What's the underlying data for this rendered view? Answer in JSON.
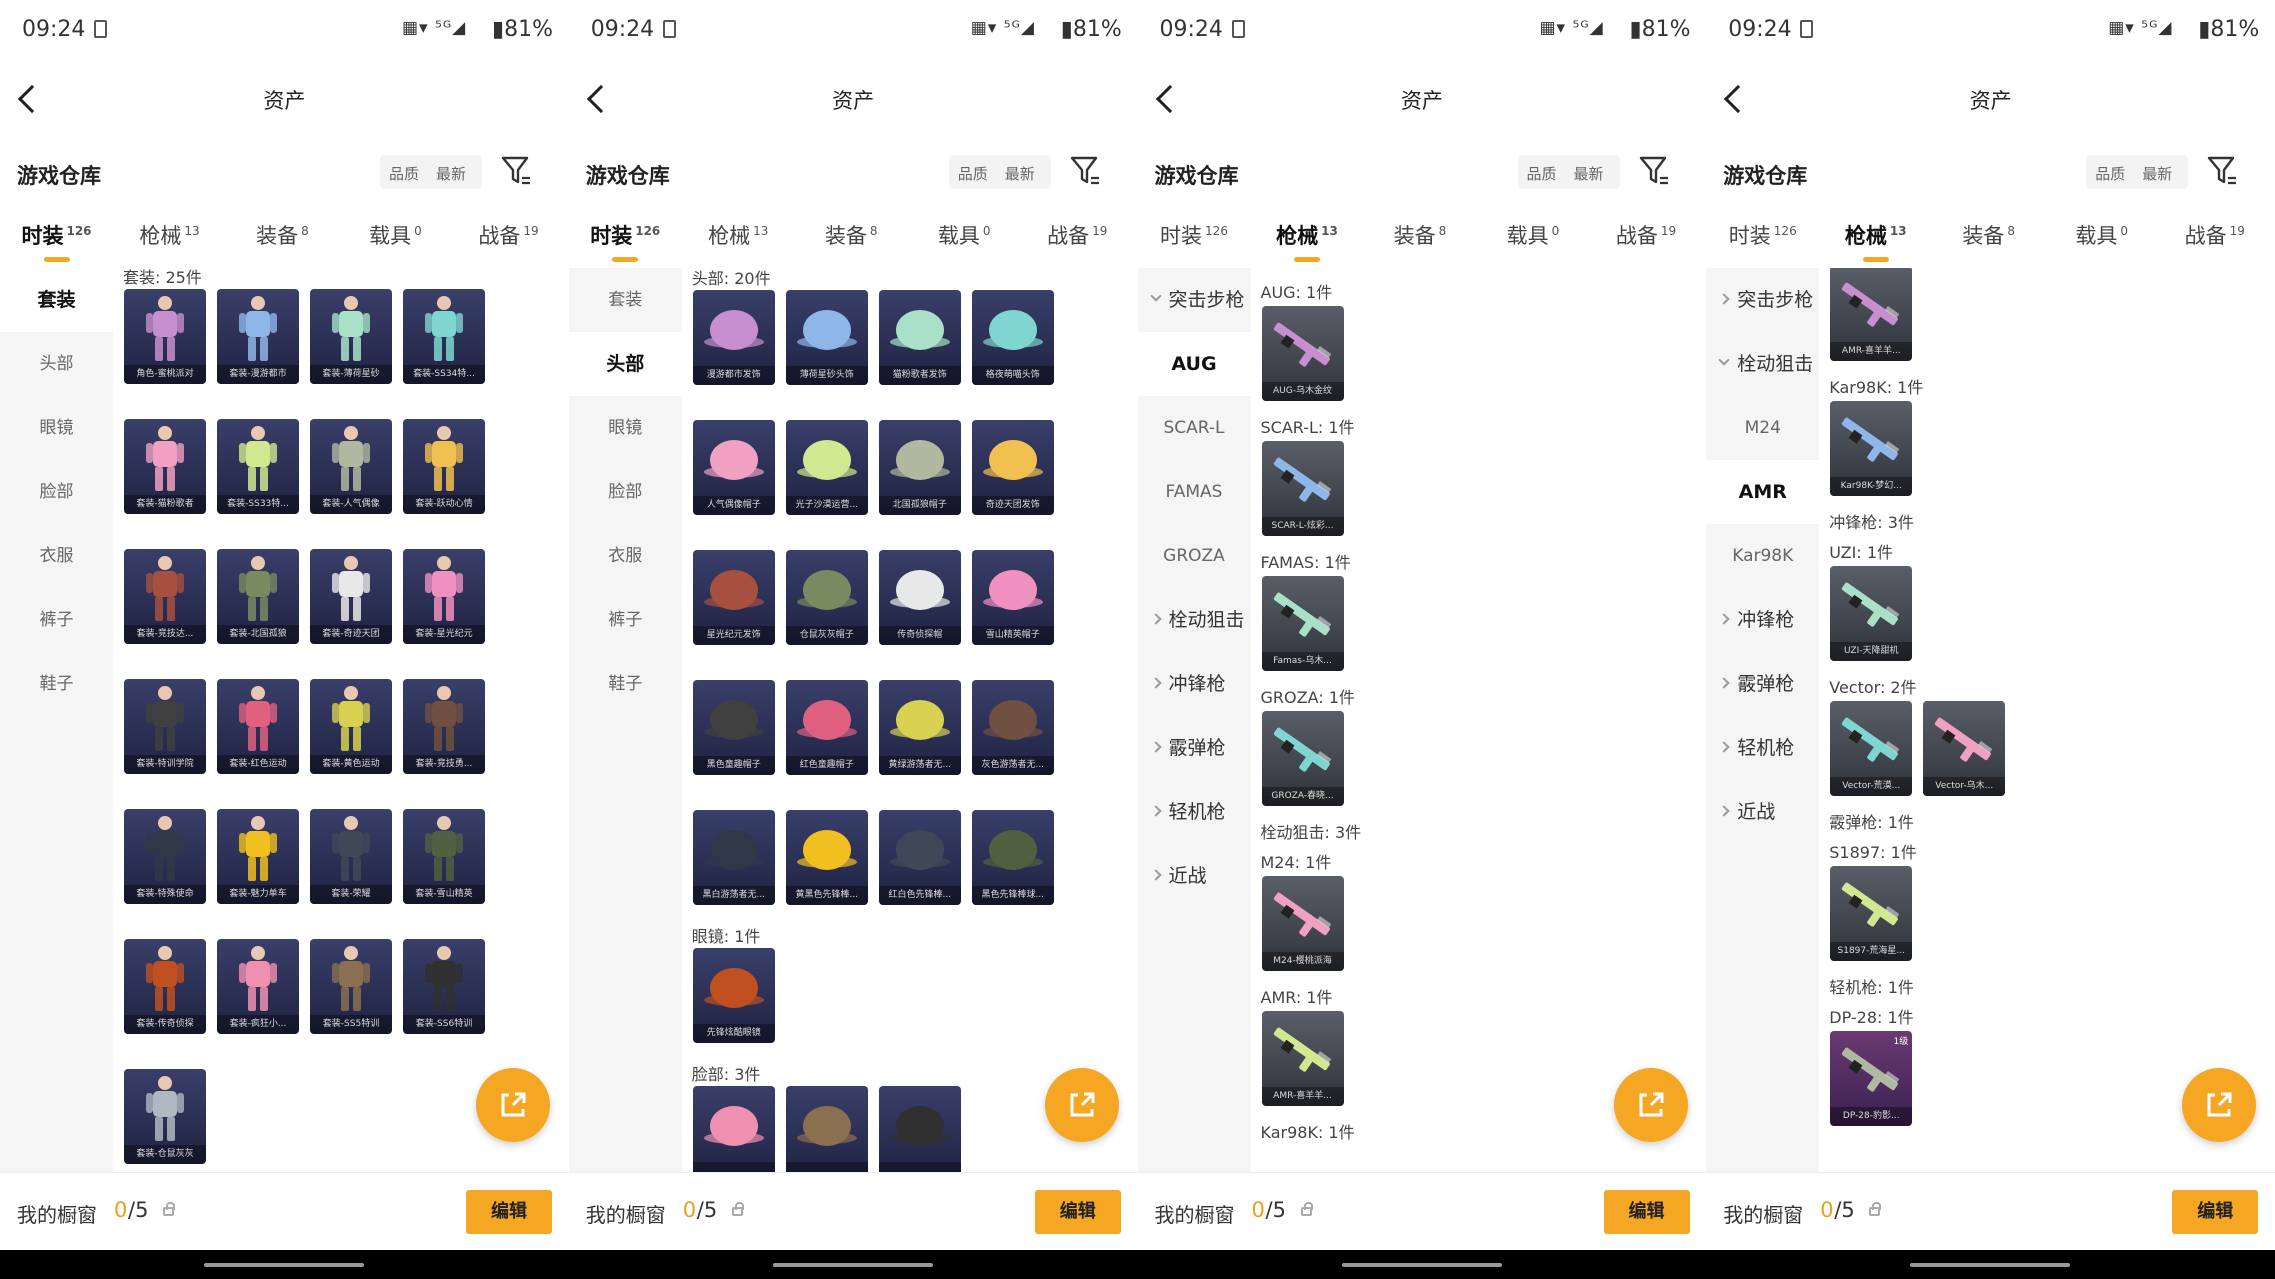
{
  "status": {
    "time": "09:24",
    "icons": "▦▾ ⁵ᴳ◢",
    "battery": "▮81%"
  },
  "header": {
    "title": "资产"
  },
  "warehouse": {
    "title": "游戏仓库",
    "sort_quality": "品质",
    "sort_latest": "最新"
  },
  "category_tabs": [
    {
      "label": "时装",
      "count": "126"
    },
    {
      "label": "枪械",
      "count": "13"
    },
    {
      "label": "装备",
      "count": "8"
    },
    {
      "label": "载具",
      "count": "0"
    },
    {
      "label": "战备",
      "count": "19"
    }
  ],
  "footer": {
    "showcase_label": "我的橱窗",
    "showcase_used": "0",
    "showcase_total": "/5",
    "edit_label": "编辑"
  },
  "colors": {
    "accent": "#f5a623",
    "sidebar_bg": "#f5f5f5",
    "card_bg": "#2a2e52"
  },
  "screens": [
    {
      "active_tab": 0,
      "sidebar": [
        {
          "label": "套装",
          "active": true
        },
        {
          "label": "头部"
        },
        {
          "label": "眼镜"
        },
        {
          "label": "脸部"
        },
        {
          "label": "衣服"
        },
        {
          "label": "裤子"
        },
        {
          "label": "鞋子"
        }
      ],
      "sections": [
        {
          "label": "套装: 25件",
          "items": [
            "角色-蜜桃派对",
            "套装-漫游都市",
            "套装-薄荷星砂",
            "套装-SS34特...",
            "套装-猫粉歌者",
            "套装-SS33特...",
            "套装-人气偶像",
            "套装-跃动心情",
            "套装-竞技达...",
            "套装-北国孤狼",
            "套装-奇迹天团",
            "套装-星光纪元",
            "套装-特训学院",
            "套装-红色运动",
            "套装-黄色运动",
            "套装-竞技勇...",
            "套装-特殊使命",
            "套装-魅力单车",
            "套装-荣耀",
            "套装-雪山精英",
            "套装-传奇侦探",
            "套装-疯狂小...",
            "套装-SS5特训",
            "套装-SS6特训",
            "套装-仓鼠灰灰"
          ]
        }
      ]
    },
    {
      "active_tab": 0,
      "sidebar": [
        {
          "label": "套装"
        },
        {
          "label": "头部",
          "active": true
        },
        {
          "label": "眼镜"
        },
        {
          "label": "脸部"
        },
        {
          "label": "衣服"
        },
        {
          "label": "裤子"
        },
        {
          "label": "鞋子"
        }
      ],
      "sections": [
        {
          "label": "头部: 20件",
          "items": [
            "漫游都市发饰",
            "薄荷星砂头饰",
            "猫粉歌者发饰",
            "格夜萌喵头饰",
            "人气偶像帽子",
            "光子沙漠运营...",
            "北国孤狼帽子",
            "奇迹天团发饰",
            "星光纪元发饰",
            "仓鼠灰灰帽子",
            "传奇侦探帽",
            "雪山精英帽子",
            "黑色童趣帽子",
            "红色童趣帽子",
            "黄绿游荡者无...",
            "灰色游荡者无...",
            "黑白游荡者无...",
            "黄黑色先锋棒...",
            "红白色先锋棒...",
            "黑色先锋棒球..."
          ]
        },
        {
          "label": "眼镜: 1件",
          "items": [
            "先锋炫酷眼镜"
          ]
        },
        {
          "label": "脸部: 3件",
          "items": [
            "",
            "",
            ""
          ]
        }
      ]
    },
    {
      "active_tab": 1,
      "sidebar": [
        {
          "label": "突击步枪",
          "group": true,
          "open": true
        },
        {
          "label": "AUG",
          "active": true
        },
        {
          "label": "SCAR-L"
        },
        {
          "label": "FAMAS"
        },
        {
          "label": "GROZA"
        },
        {
          "label": "栓动狙击",
          "group": true
        },
        {
          "label": "冲锋枪",
          "group": true
        },
        {
          "label": "霰弹枪",
          "group": true
        },
        {
          "label": "轻机枪",
          "group": true
        },
        {
          "label": "近战",
          "group": true
        }
      ],
      "sections": [
        {
          "label": "AUG: 1件",
          "items": [
            "AUG-乌木金纹"
          ]
        },
        {
          "label": "SCAR-L: 1件",
          "items": [
            "SCAR-L-炫彩..."
          ]
        },
        {
          "label": "FAMAS: 1件",
          "items": [
            "Famas-乌木..."
          ]
        },
        {
          "label": "GROZA: 1件",
          "items": [
            "GROZA-春晓..."
          ]
        },
        {
          "label": "栓动狙击: 3件",
          "items": []
        },
        {
          "label": "M24: 1件",
          "items": [
            "M24-樱桃派海"
          ]
        },
        {
          "label": "AMR: 1件",
          "items": [
            "AMR-喜羊羊..."
          ]
        },
        {
          "label": "Kar98K: 1件",
          "items": []
        }
      ]
    },
    {
      "active_tab": 1,
      "sidebar": [
        {
          "label": "突击步枪",
          "group": true
        },
        {
          "label": "栓动狙击",
          "group": true,
          "open": true
        },
        {
          "label": "M24"
        },
        {
          "label": "AMR",
          "active": true
        },
        {
          "label": "Kar98K"
        },
        {
          "label": "冲锋枪",
          "group": true
        },
        {
          "label": "霰弹枪",
          "group": true
        },
        {
          "label": "轻机枪",
          "group": true
        },
        {
          "label": "近战",
          "group": true
        }
      ],
      "sections": [
        {
          "label": "",
          "items": [
            "AMR-喜羊羊..."
          ]
        },
        {
          "label": "Kar98K: 1件",
          "items": [
            "Kar98K-梦幻..."
          ]
        },
        {
          "label": "冲锋枪: 3件",
          "items": []
        },
        {
          "label": "UZI: 1件",
          "items": [
            "UZI-天降甜机"
          ]
        },
        {
          "label": "Vector: 2件",
          "items": [
            "Vector-荒漠...",
            "Vector-乌木..."
          ]
        },
        {
          "label": "霰弹枪: 1件",
          "items": []
        },
        {
          "label": "S1897: 1件",
          "items": [
            "S1897-荒海星..."
          ]
        },
        {
          "label": "轻机枪: 1件",
          "items": []
        },
        {
          "label": "DP-28: 1件",
          "items": [
            "DP-28-豹影..."
          ],
          "badge": "1级"
        }
      ]
    }
  ]
}
